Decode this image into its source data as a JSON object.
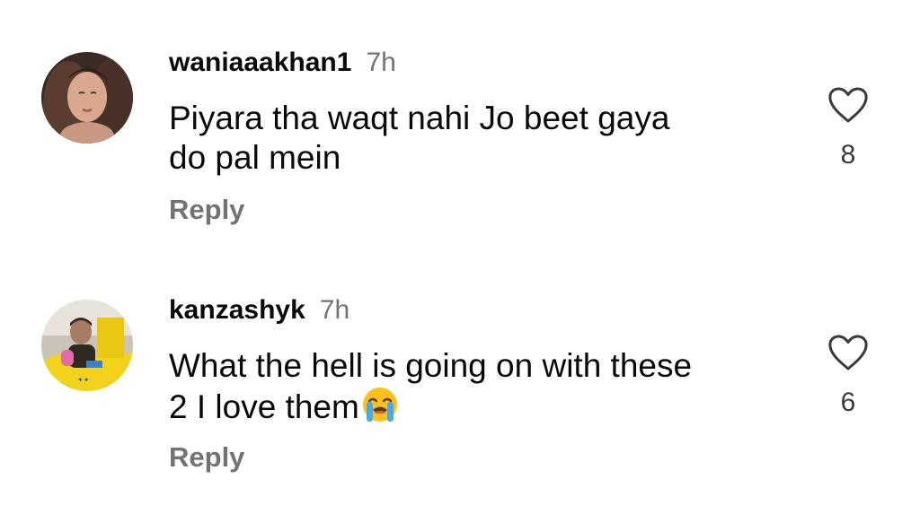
{
  "comments": [
    {
      "username": "waniaaakhan1",
      "timestamp": "7h",
      "text_lines": [
        "Piyara tha waqt nahi Jo beet gaya",
        "do pal mein"
      ],
      "reply_label": "Reply",
      "like_count": "8",
      "like_icon": "heart-outline-icon"
    },
    {
      "username": "kanzashyk",
      "timestamp": "7h",
      "text_lines": [
        "What the hell is going on with these",
        "2 I love them"
      ],
      "emoji": "😭",
      "reply_label": "Reply",
      "like_count": "6",
      "like_icon": "heart-outline-icon"
    }
  ],
  "colors": {
    "primary_text": "#0a0a0a",
    "secondary_text": "#737373",
    "like_count": "#3a3a3a",
    "background": "#ffffff"
  }
}
